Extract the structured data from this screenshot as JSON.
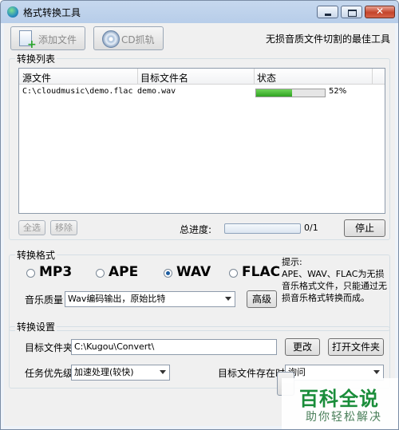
{
  "window": {
    "title": "格式转换工具"
  },
  "toolbar": {
    "add_file_label": "添加文件",
    "cd_rip_label": "CD抓轨",
    "tagline": "无损音质文件切割的最佳工具"
  },
  "conversion_list": {
    "group_title": "转换列表",
    "columns": [
      "源文件",
      "目标文件名",
      "状态"
    ],
    "rows": [
      {
        "source": "C:\\cloudmusic\\demo.flac",
        "target": "demo.wav",
        "progress": 0.52,
        "progress_text": "52%"
      }
    ]
  },
  "list_actions": {
    "select_all": "全选",
    "remove": "移除",
    "total_label": "总进度:",
    "total_progress": 0,
    "total_count": "0/1",
    "stop": "停止"
  },
  "format": {
    "group_title": "转换格式",
    "options": [
      "MP3",
      "APE",
      "WAV",
      "FLAC"
    ],
    "selected": "WAV",
    "quality_label": "音乐质量",
    "quality_value": "Wav编码输出，原始比特",
    "advanced": "高级",
    "hint": "提示:\n  APE、WAV、FLAC为无损音乐格式文件，只能通过无损音乐格式转换而成。"
  },
  "settings": {
    "group_title": "转换设置",
    "target_folder_label": "目标文件夹",
    "target_folder_value": "C:\\Kugou\\Convert\\",
    "change": "更改",
    "open_folder": "打开文件夹",
    "priority_label": "任务优先级",
    "priority_value": "加速处理(较快)",
    "exists_label": "目标文件存在时",
    "exists_value": "询问"
  },
  "watermark": {
    "main": "百科全说",
    "sub": "助你轻松解决"
  },
  "colors": {
    "progress_green": "#3fb32f",
    "watermark_green": "#1a8d3a",
    "close_red": "#c4442b"
  }
}
